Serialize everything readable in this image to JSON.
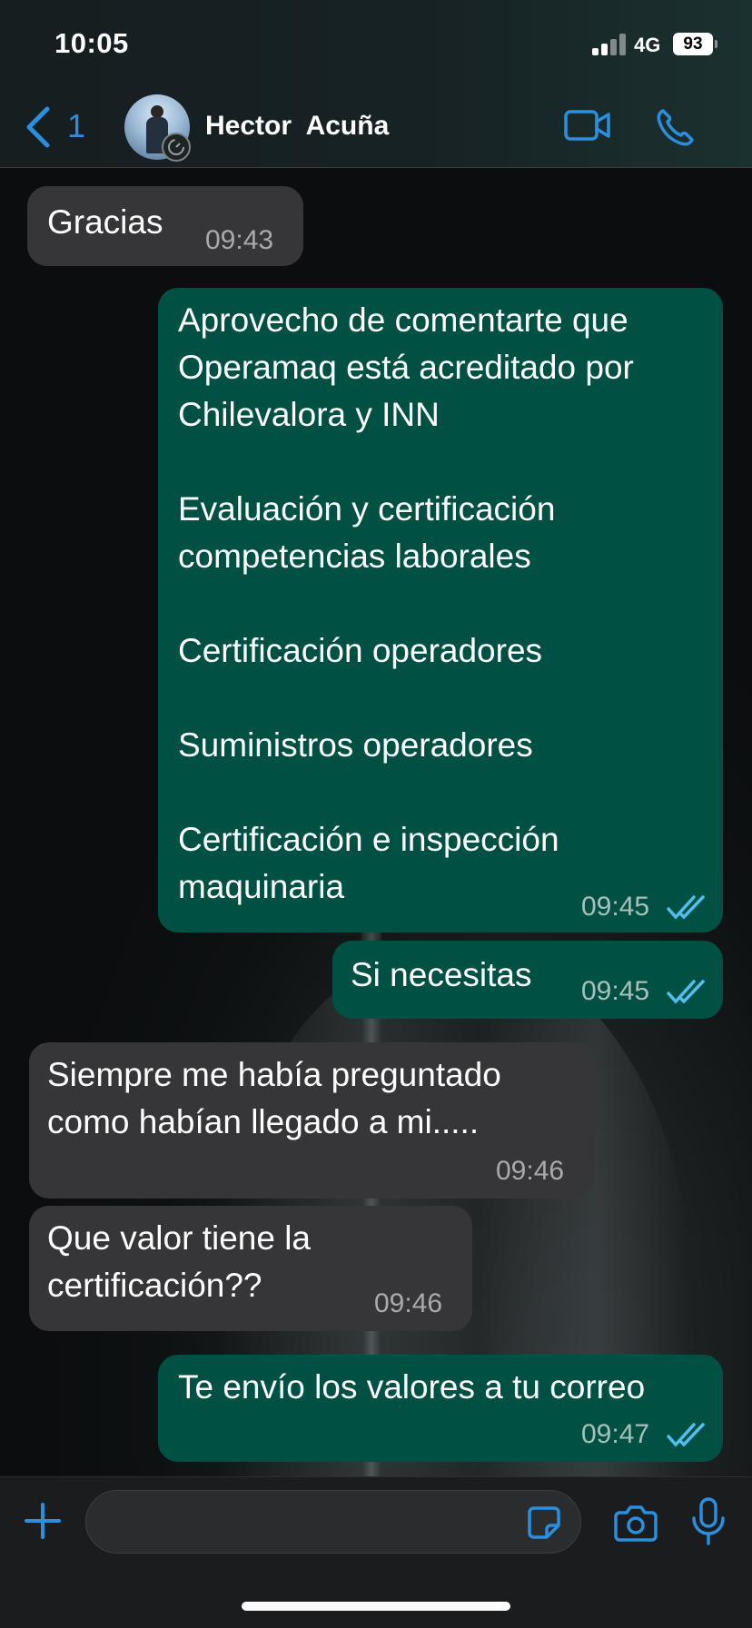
{
  "status_bar": {
    "time": "10:05",
    "network": "4G",
    "battery": "93"
  },
  "header": {
    "back_count": "1",
    "contact_name": "Hector  Acuña",
    "icons": [
      "chevron-left-icon",
      "video-icon",
      "phone-icon"
    ]
  },
  "messages": [
    {
      "direction": "in",
      "text": "Gracias",
      "time": "09:43"
    },
    {
      "direction": "out",
      "text": "Aprovecho de comentarte que\nOperamaq está acreditado por\nChilevalora y INN\n\nEvaluación y certificación\ncompetencias laborales\n\nCertificación operadores\n\nSuministros operadores\n\nCertificación e inspección\nmaquinaria",
      "time": "09:45",
      "read": true
    },
    {
      "direction": "out",
      "text": "Si necesitas",
      "time": "09:45",
      "read": true
    },
    {
      "direction": "in",
      "text": "Siempre me había preguntado\ncomo habían llegado a mi.....",
      "time": "09:46"
    },
    {
      "direction": "in",
      "text": "Que valor tiene la\ncertificación??",
      "time": "09:46"
    },
    {
      "direction": "out",
      "text": "Te envío los valores a tu correo",
      "time": "09:47",
      "read": true
    }
  ],
  "input_bar": {
    "placeholder": "",
    "icons": [
      "plus-icon",
      "sticker-icon",
      "camera-icon",
      "microphone-icon"
    ]
  },
  "colors": {
    "accent": "#2b8fe0",
    "outgoing_bubble": "#005143",
    "incoming_bubble": "#363638",
    "read_tick": "#53bdeb"
  }
}
